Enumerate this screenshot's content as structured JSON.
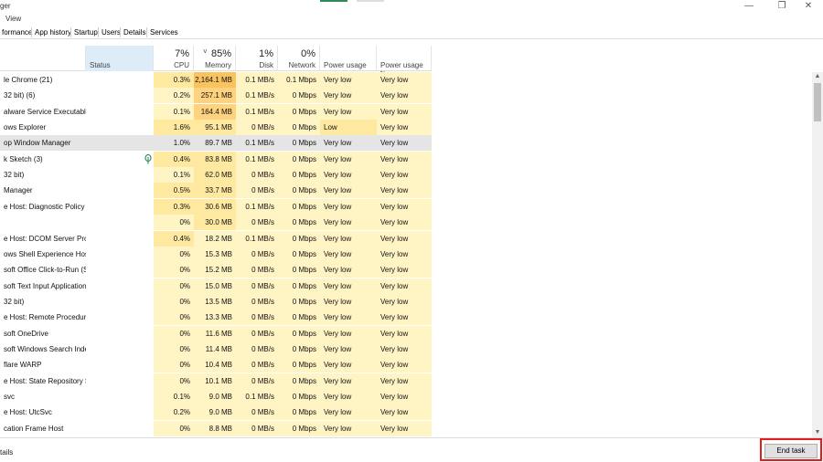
{
  "window": {
    "title_fragment": "ger",
    "min_glyph": "—",
    "max_glyph": "❐",
    "close_glyph": "✕"
  },
  "menu": {
    "view": "View"
  },
  "tabs": [
    "formance",
    "App history",
    "Startup",
    "Users",
    "Details",
    "Services"
  ],
  "columns": {
    "status": "Status",
    "cpu": {
      "pct": "7%",
      "name": "CPU"
    },
    "memory": {
      "pct": "85%",
      "name": "Memory"
    },
    "disk": {
      "pct": "1%",
      "name": "Disk"
    },
    "network": {
      "pct": "0%",
      "name": "Network"
    },
    "power_usage": "Power usage",
    "power_usage_trend": "Power usage tr..."
  },
  "sort_glyph": "˅",
  "icons": {
    "leaf": "leaf-icon",
    "scroll_up": "▲",
    "scroll_down": "▼"
  },
  "colors": {
    "heat_light": "#fff4c4",
    "heat_mid": "#ffe9a1",
    "heat_high": "#ffd280",
    "heat_max": "#f9c460",
    "status_header": "#dcecf9",
    "selected_row": "#e5e5e5",
    "highlight_box": "#e01e1e"
  },
  "rows": [
    {
      "name": "le Chrome (21)",
      "cpu": "0.3%",
      "mem": "2,164.1 MB",
      "disk": "0.1 MB/s",
      "net": "0.1 Mbps",
      "pw": "Very low",
      "pwt": "Very low",
      "mem_heat": "max"
    },
    {
      "name": "32 bit) (6)",
      "cpu": "0.2%",
      "mem": "257.1 MB",
      "disk": "0.1 MB/s",
      "net": "0 Mbps",
      "pw": "Very low",
      "pwt": "Very low"
    },
    {
      "name": "alware Service Executable",
      "cpu": "0.1%",
      "mem": "164.4 MB",
      "disk": "0.1 MB/s",
      "net": "0 Mbps",
      "pw": "Very low",
      "pwt": "Very low"
    },
    {
      "name": "ows Explorer",
      "cpu": "1.6%",
      "mem": "95.1 MB",
      "disk": "0 MB/s",
      "net": "0 Mbps",
      "pw": "Low",
      "pwt": "Very low",
      "pw_heat": "mid"
    },
    {
      "name": "op Window Manager",
      "cpu": "1.0%",
      "mem": "89.7 MB",
      "disk": "0.1 MB/s",
      "net": "0 Mbps",
      "pw": "Very low",
      "pwt": "Very low",
      "selected": true
    },
    {
      "name": "k Sketch (3)",
      "cpu": "0.4%",
      "mem": "83.8 MB",
      "disk": "0.1 MB/s",
      "net": "0 Mbps",
      "pw": "Very low",
      "pwt": "Very low",
      "leaf": true
    },
    {
      "name": "32 bit)",
      "cpu": "0.1%",
      "mem": "62.0 MB",
      "disk": "0 MB/s",
      "net": "0 Mbps",
      "pw": "Very low",
      "pwt": "Very low"
    },
    {
      "name": "Manager",
      "cpu": "0.5%",
      "mem": "33.7 MB",
      "disk": "0 MB/s",
      "net": "0 Mbps",
      "pw": "Very low",
      "pwt": "Very low"
    },
    {
      "name": "e Host: Diagnostic Policy ...",
      "cpu": "0.3%",
      "mem": "30.6 MB",
      "disk": "0.1 MB/s",
      "net": "0 Mbps",
      "pw": "Very low",
      "pwt": "Very low"
    },
    {
      "name": "",
      "cpu": "0%",
      "mem": "30.0 MB",
      "disk": "0 MB/s",
      "net": "0 Mbps",
      "pw": "Very low",
      "pwt": "Very low"
    },
    {
      "name": "e Host: DCOM Server Proc...",
      "cpu": "0.4%",
      "mem": "18.2 MB",
      "disk": "0.1 MB/s",
      "net": "0 Mbps",
      "pw": "Very low",
      "pwt": "Very low"
    },
    {
      "name": "ows Shell Experience Host",
      "cpu": "0%",
      "mem": "15.3 MB",
      "disk": "0 MB/s",
      "net": "0 Mbps",
      "pw": "Very low",
      "pwt": "Very low"
    },
    {
      "name": "soft Office Click-to-Run (S...",
      "cpu": "0%",
      "mem": "15.2 MB",
      "disk": "0 MB/s",
      "net": "0 Mbps",
      "pw": "Very low",
      "pwt": "Very low"
    },
    {
      "name": "soft Text Input Application",
      "cpu": "0%",
      "mem": "15.0 MB",
      "disk": "0 MB/s",
      "net": "0 Mbps",
      "pw": "Very low",
      "pwt": "Very low"
    },
    {
      "name": "32 bit)",
      "cpu": "0%",
      "mem": "13.5 MB",
      "disk": "0 MB/s",
      "net": "0 Mbps",
      "pw": "Very low",
      "pwt": "Very low"
    },
    {
      "name": "e Host: Remote Procedure...",
      "cpu": "0%",
      "mem": "13.3 MB",
      "disk": "0 MB/s",
      "net": "0 Mbps",
      "pw": "Very low",
      "pwt": "Very low"
    },
    {
      "name": "soft OneDrive",
      "cpu": "0%",
      "mem": "11.6 MB",
      "disk": "0 MB/s",
      "net": "0 Mbps",
      "pw": "Very low",
      "pwt": "Very low"
    },
    {
      "name": "soft Windows Search Inde...",
      "cpu": "0%",
      "mem": "11.4 MB",
      "disk": "0 MB/s",
      "net": "0 Mbps",
      "pw": "Very low",
      "pwt": "Very low"
    },
    {
      "name": "flare WARP",
      "cpu": "0%",
      "mem": "10.4 MB",
      "disk": "0 MB/s",
      "net": "0 Mbps",
      "pw": "Very low",
      "pwt": "Very low"
    },
    {
      "name": "e Host: State Repository S...",
      "cpu": "0%",
      "mem": "10.1 MB",
      "disk": "0 MB/s",
      "net": "0 Mbps",
      "pw": "Very low",
      "pwt": "Very low"
    },
    {
      "name": "svc",
      "cpu": "0.1%",
      "mem": "9.0 MB",
      "disk": "0.1 MB/s",
      "net": "0 Mbps",
      "pw": "Very low",
      "pwt": "Very low"
    },
    {
      "name": "e Host: UtcSvc",
      "cpu": "0.2%",
      "mem": "9.0 MB",
      "disk": "0 MB/s",
      "net": "0 Mbps",
      "pw": "Very low",
      "pwt": "Very low"
    },
    {
      "name": "cation Frame Host",
      "cpu": "0%",
      "mem": "8.8 MB",
      "disk": "0 MB/s",
      "net": "0 Mbps",
      "pw": "Very low",
      "pwt": "Very low"
    }
  ],
  "footer": {
    "fewer_details": "tails",
    "end_task": "End task"
  }
}
